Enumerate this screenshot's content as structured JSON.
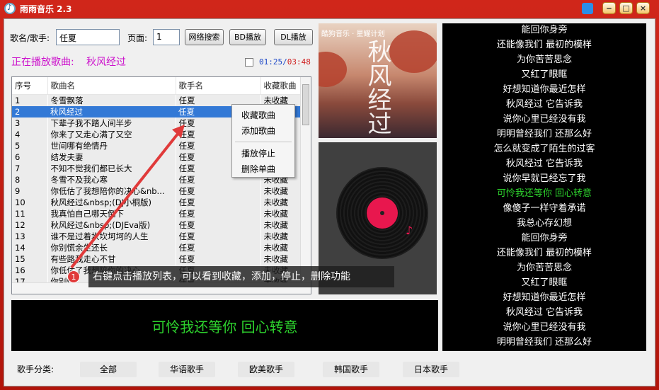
{
  "titlebar": {
    "title": "雨雨音乐 2.3",
    "min": "‒",
    "max": "□",
    "close": "×"
  },
  "search": {
    "label_song_artist": "歌名/歌手:",
    "query": "任夏",
    "label_page": "页面:",
    "page": "1",
    "net_search": "网络搜索",
    "bd_play": "BD播放",
    "dl_play": "DL播放"
  },
  "nowplaying": {
    "label": "正在播放歌曲:",
    "song": "秋风经过",
    "elapsed": "01:25",
    "separator": "/",
    "total": "03:48"
  },
  "table": {
    "headers": [
      "序号",
      "歌曲名",
      "歌手名",
      "收藏歌曲"
    ],
    "selected_index": 1,
    "rows": [
      [
        "1",
        "冬雪飘落",
        "任夏",
        "未收藏"
      ],
      [
        "2",
        "秋风经过",
        "任夏",
        "未收藏"
      ],
      [
        "3",
        "下辈子我不踏人间半步",
        "任夏",
        "未收藏"
      ],
      [
        "4",
        "你来了又走心满了又空",
        "任夏",
        "未收藏"
      ],
      [
        "5",
        "世间哪有绝情丹",
        "任夏",
        "未收藏"
      ],
      [
        "6",
        "结发夫妻",
        "任夏",
        "未收藏"
      ],
      [
        "7",
        "不知不觉我们都已长大",
        "任夏",
        "未收藏"
      ],
      [
        "8",
        "冬雪不及我心寒",
        "任夏",
        "未收藏"
      ],
      [
        "9",
        "你低估了我想陪你的决心&nb...",
        "任夏",
        "未收藏"
      ],
      [
        "10",
        "秋风经过&nbsp;(DJ小桐版)",
        "任夏",
        "未收藏"
      ],
      [
        "11",
        "我真怕自己哪天倒下",
        "任夏",
        "未收藏"
      ],
      [
        "12",
        "秋风经过&nbsp;(DJEva版)",
        "任夏",
        "未收藏"
      ],
      [
        "13",
        "谁不是过着坎坎坷坷的人生",
        "任夏",
        "未收藏"
      ],
      [
        "14",
        "你别慌余生还长",
        "任夏",
        "未收藏"
      ],
      [
        "15",
        "有些路我走心不甘",
        "任夏",
        "未收藏"
      ],
      [
        "16",
        "你低估了我想陪你的决心",
        "任夏",
        "未收藏"
      ],
      [
        "17",
        "你别慌",
        "任夏",
        "未收藏"
      ]
    ]
  },
  "context_menu": {
    "collect": "收藏歌曲",
    "add": "添加歌曲",
    "stop": "播放停止",
    "delete": "删除单曲"
  },
  "cover": {
    "brand": "酷狗音乐 · 星耀计划",
    "title": "秋风经过"
  },
  "lyric_current": "可怜我还等你  回心转意",
  "lyrics": {
    "current_index": 11,
    "lines": [
      "能回你身旁",
      "还能像我们 最初的模样",
      "为你苦苦思念",
      "又红了眼眶",
      "好想知道你最近怎样",
      "秋风经过 它告诉我",
      "说你心里已经没有我",
      "明明曾经我们 还那么好",
      "怎么就变成了陌生的过客",
      "秋风经过 它告诉我",
      "说你早就已经忘了我",
      "可怜我还等你 回心转意",
      "像傻子一样守着承诺",
      "我总心存幻想",
      "能回你身旁",
      "还能像我们 最初的模样",
      "为你苦苦思念",
      "又红了眼眶",
      "好想知道你最近怎样",
      "秋风经过 它告诉我",
      "说你心里已经没有我",
      "明明曾经我们 还那么好"
    ]
  },
  "categories": {
    "label": "歌手分类:",
    "items": [
      "全部",
      "华语歌手",
      "欧美歌手",
      "韩国歌手",
      "日本歌手"
    ]
  },
  "tutorial": {
    "step": "1",
    "text": "右键点击播放列表，可以看到收藏，添加，停止，删除功能",
    "color": "#e03a3a"
  },
  "colors": {
    "frame": "#c21a0e",
    "lyric_highlight": "#2dd02d",
    "now_playing": "#cc10cc",
    "selection": "#3379d6"
  }
}
